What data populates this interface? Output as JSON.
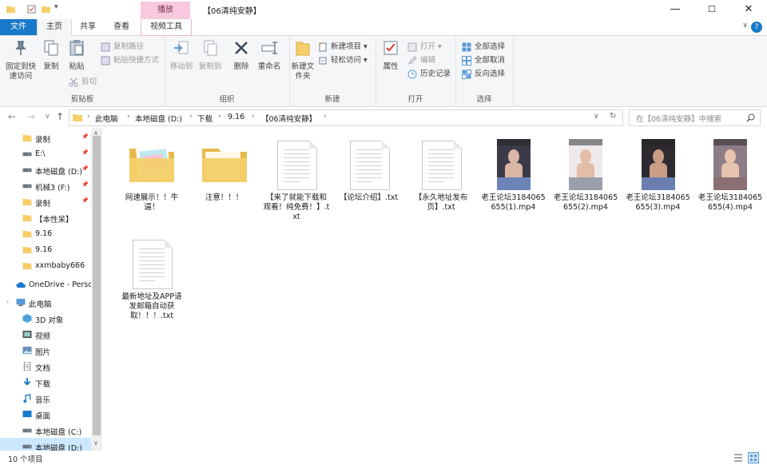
{
  "window": {
    "title": "【06清纯安静】",
    "context_tab": "播放",
    "controls": {
      "minimize": "—",
      "maximize": "☐",
      "close": "✕"
    }
  },
  "ribbon_tabs": [
    "文件",
    "主页",
    "共享",
    "查看",
    "视频工具"
  ],
  "ribbon": {
    "clipboard": {
      "label": "剪贴板",
      "pin": "固定到快速访问",
      "copy": "复制",
      "paste": "粘贴",
      "copy_path": "复制路径",
      "paste_shortcut": "粘贴快捷方式",
      "cut": "剪切"
    },
    "organize": {
      "label": "组织",
      "move_to": "移动到",
      "copy_to": "复制到",
      "delete": "删除",
      "rename": "重命名"
    },
    "new": {
      "label": "新建",
      "new_folder": "新建文件夹",
      "new_item": "新建项目",
      "easy_access": "轻松访问"
    },
    "open": {
      "label": "打开",
      "properties": "属性",
      "open": "打开",
      "edit": "编辑",
      "history": "历史记录"
    },
    "select": {
      "label": "选择",
      "select_all": "全部选择",
      "select_none": "全部取消",
      "invert": "反向选择"
    }
  },
  "address": {
    "crumbs": [
      "此电脑",
      "本地磁盘 (D:)",
      "下载",
      "9.16",
      "【06清纯安静】"
    ],
    "search_placeholder": "在【06清纯安静】中搜索"
  },
  "nav": {
    "items": [
      {
        "label": "录制",
        "icon": "folder",
        "pinned": true
      },
      {
        "label": "E:\\",
        "icon": "drive",
        "pinned": true
      },
      {
        "label": "本地磁盘 (D:)",
        "icon": "drive",
        "pinned": true
      },
      {
        "label": "机械3 (F:)",
        "icon": "drive",
        "pinned": true
      },
      {
        "label": "录制",
        "icon": "folder",
        "pinned": true
      },
      {
        "label": "【本性呆】",
        "icon": "folder",
        "pinned": false
      },
      {
        "label": "9.16",
        "icon": "folder",
        "pinned": false
      },
      {
        "label": "9.16",
        "icon": "folder",
        "pinned": false
      },
      {
        "label": "xxmbaby666",
        "icon": "folder",
        "pinned": false
      },
      {
        "label": "OneDrive - Perso",
        "icon": "cloud",
        "pinned": false
      },
      {
        "label": "此电脑",
        "icon": "pc",
        "pinned": false
      },
      {
        "label": "3D 对象",
        "icon": "3d",
        "pinned": false
      },
      {
        "label": "视频",
        "icon": "video",
        "pinned": false
      },
      {
        "label": "图片",
        "icon": "picture",
        "pinned": false
      },
      {
        "label": "文档",
        "icon": "doc",
        "pinned": false
      },
      {
        "label": "下载",
        "icon": "download",
        "pinned": false
      },
      {
        "label": "音乐",
        "icon": "music",
        "pinned": false
      },
      {
        "label": "桌面",
        "icon": "desktop",
        "pinned": false
      },
      {
        "label": "本地磁盘 (C:)",
        "icon": "drive",
        "pinned": false
      },
      {
        "label": "本地磁盘 (D:)",
        "icon": "drive",
        "pinned": false
      }
    ]
  },
  "files": [
    {
      "name": "网速展示！！牛逼！",
      "type": "folder-doc"
    },
    {
      "name": "注意！！！",
      "type": "folder"
    },
    {
      "name": "【来了就能下载和观看！纯免费！】.txt",
      "type": "txt"
    },
    {
      "name": "【论坛介绍】.txt",
      "type": "txt"
    },
    {
      "name": "【永久地址发布页】.txt",
      "type": "txt"
    },
    {
      "name": "老王论坛3184065655(1).mp4",
      "type": "video"
    },
    {
      "name": "老王论坛3184065655(2).mp4",
      "type": "video"
    },
    {
      "name": "老王论坛3184065655(3).mp4",
      "type": "video"
    },
    {
      "name": "老王论坛3184065655(4).mp4",
      "type": "video"
    },
    {
      "name": "最新地址及APP请发邮箱自动获取！！！.txt",
      "type": "txt"
    }
  ],
  "status": {
    "count": "10 个项目"
  },
  "colors": {
    "accent": "#1979ca",
    "context_tab": "#f7c8de",
    "folder": "#f4cf6a"
  }
}
